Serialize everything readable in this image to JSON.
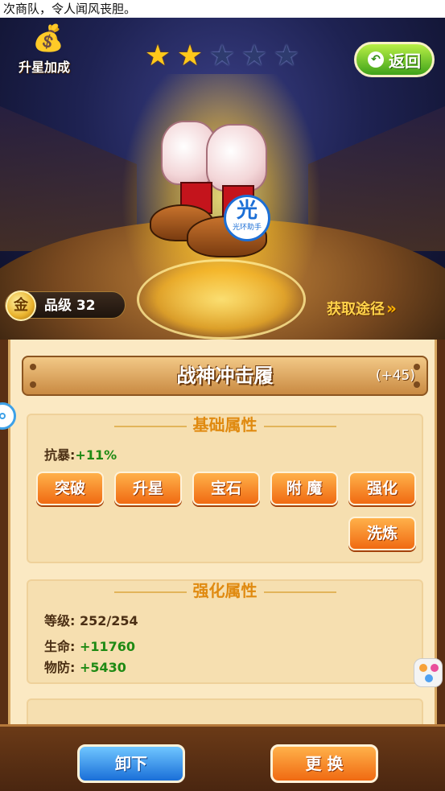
{
  "ticker": {
    "text": "次商队，令人闻风丧胆。"
  },
  "header": {
    "star_boost_label": "升星加成",
    "stars_filled": 2,
    "stars_total": 5,
    "back_label": "返回"
  },
  "item": {
    "badge_glyph": "光",
    "badge_text": "光环助手",
    "grade_coin": "金",
    "grade_label": "品级 32",
    "source_label": "获取途径",
    "name": "战神冲击履",
    "enhance_level": "(+45)"
  },
  "basic": {
    "title": "基础属性",
    "attr_label": "抗暴:",
    "attr_value": "+11%",
    "buttons": [
      "突破",
      "升星",
      "宝石",
      "附 魔",
      "强化",
      "洗炼"
    ]
  },
  "enhance": {
    "title": "强化属性",
    "level_label": "等级:",
    "level_value": "252/254",
    "hp_label": "生命:",
    "hp_value": "+11760",
    "def_label": "物防:",
    "def_value": "+5430"
  },
  "footer": {
    "unequip_label": "卸下",
    "replace_label": "更 换"
  },
  "colors": {
    "accent_orange": "#f06a12",
    "value_green": "#1f8a14",
    "section_title": "#e08a10",
    "back_green": "#3fa21a",
    "unequip_blue": "#1a6fd8"
  }
}
